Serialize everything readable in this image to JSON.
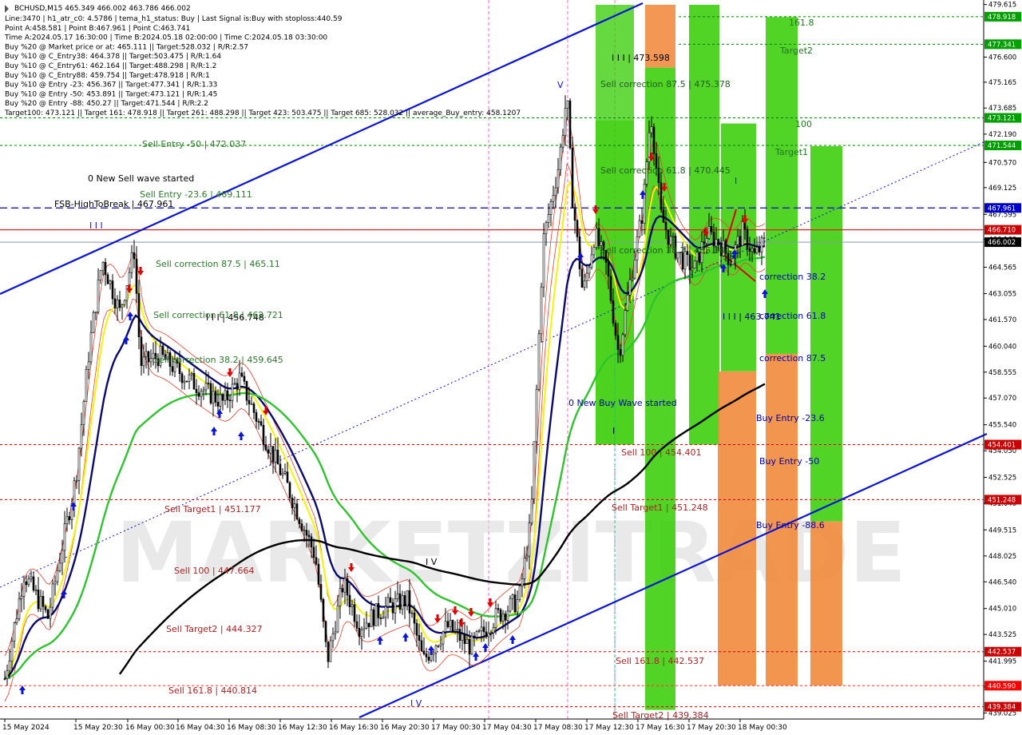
{
  "window": {
    "symbol_line": "BCHUSD,M15  465.349 466.002 463.786 466.002"
  },
  "info_lines": [
    "Line:3470 | h1_atr_c0: 4.5786 | tema_h1_status: Buy | Last Signal is:Buy with stoploss:440.59",
    "Point A:458.581 | Point B:467.961 | Point C:463.741",
    "Time A:2024.05.17 16:30:00 | Time B:2024.05.18 02:00:00 | Time C:2024.05.18 03:30:00",
    "Buy %20 @ Market price or at: 465.111 || Target:528.032 | R/R:2.57",
    "Buy %10 @ C_Entry38: 464.378 || Target:503.475 | R/R:1.64",
    "Buy %10 @ C_Entry61: 462.164 || Target:488.298 | R/R:1.2",
    "Buy %10 @ C_Entry88: 459.754 || Target:478.918 | R/R:1",
    "Buy %10 @ Entry -23: 456.367 || Target:477.341 | R/R:1.33",
    "Buy %10 @ Entry -50: 453.891 || Target:473.121 | R/R:1.45",
    "Buy %20 @ Entry -88: 450.27 || Target:471.544 | R/R:2.2",
    "Target100: 473.121 || Target 161: 478.918 || Target 261: 488.298 || Target 423: 503.475 || Target 685: 528.032 || average_Buy_entry: 458.1207"
  ],
  "watermark": "MARKETZITRADE",
  "colors": {
    "background": "#ffffff",
    "candle": "#000000",
    "channel": "#0a14d8",
    "ma_black": "#000000",
    "ma_navy": "#0a0a6e",
    "ma_yellow": "#f5f500",
    "ma_green": "#2ec42e",
    "envelope": "#e8402a",
    "green_zone": "#33cc00",
    "orange_zone": "#f08a3c",
    "red_level": "#c80000",
    "green_level": "#008000",
    "blue_level": "#0000cc",
    "buy_arrow": "#0a14d8",
    "sell_arrow": "#e00000"
  },
  "chart_labels": {
    "roman_III": "I I I",
    "roman_IV_a": "I V",
    "roman_IV_b": "I V",
    "roman_V": "V",
    "roman_I": "I",
    "roman_I_green": "I",
    "III_473598": "I I I | 473.598",
    "III_456748": "I I I | 456.748",
    "III_463741": "I I I | 463.741",
    "new_sell_wave": "0 New Sell wave started",
    "new_buy_wave": "0 New Buy Wave started",
    "fsb": "FSB-HighToBreak | 467.961",
    "sell_entry_50": "Sell Entry -50 | 472.037",
    "sell_entry_236": "Sell Entry -23.6 | 469.111",
    "sell_corr_875_a": "Sell correction 87.5 | 465.11",
    "sell_corr_618_a": "Sell correction 61.8 | 462.721",
    "sell_corr_382_a": "Sell correction 38.2 | 459.645",
    "sell_target1_a": "Sell Target1 | 451.177",
    "sell_100_a": "Sell 100 | 447.664",
    "sell_target2_a": "Sell Target2 | 444.327",
    "sell_1618_a": "Sell 161.8 | 440.814",
    "sell_corr_875_b": "Sell correction 87.5 | 475.378",
    "sell_corr_618_b": "Sell correction 61.8 | 470.445",
    "sell_corr_382_b": "Sell correction 38.2 | 465.344",
    "sell_100_b": "Sell 100 | 454.401",
    "sell_target1_b": "Sell Target1 | 451.248",
    "sell_1618_b": "Sell 161.8 | 442.537",
    "sell_target2_b": "Sell Target2 | 439.384",
    "t1618": "161.8",
    "target2": "Target2",
    "t100": "100",
    "target1": "Target1",
    "corr_382": "correction 38.2",
    "corr_618": "correction 61.8",
    "corr_875": "correction 87.5",
    "buy_entry_236": "Buy Entry -23.6",
    "buy_entry_50": "Buy Entry -50",
    "buy_entry_886": "Buy Entry -88.6"
  },
  "price_ticks": [
    "479.615",
    "476.600",
    "475.165",
    "473.685",
    "472.190",
    "470.570",
    "469.125",
    "467.595",
    "466.160",
    "464.565",
    "463.055",
    "461.570",
    "460.040",
    "458.555",
    "457.070",
    "455.540",
    "454.050",
    "452.525",
    "451.040",
    "449.515",
    "448.025",
    "446.540",
    "445.010",
    "443.525",
    "441.995",
    "440.510",
    "439.025"
  ],
  "price_badges": [
    {
      "text": "478.918",
      "color": "#00a000"
    },
    {
      "text": "477.341",
      "color": "#00a000"
    },
    {
      "text": "473.121",
      "color": "#00a000"
    },
    {
      "text": "471.544",
      "color": "#00a000"
    },
    {
      "text": "467.961",
      "color": "#0000cc"
    },
    {
      "text": "466.710",
      "color": "#cc0000"
    },
    {
      "text": "466.002",
      "color": "#000000"
    },
    {
      "text": "454.401",
      "color": "#cc0000"
    },
    {
      "text": "451.248",
      "color": "#cc0000"
    },
    {
      "text": "442.537",
      "color": "#cc0000"
    },
    {
      "text": "440.590",
      "color": "#ff0000"
    },
    {
      "text": "439.384",
      "color": "#cc0000"
    }
  ],
  "time_ticks": [
    "15 May 2024",
    "15 May 20:30",
    "16 May 00:30",
    "16 May 04:30",
    "16 May 08:30",
    "16 May 12:30",
    "16 May 16:30",
    "16 May 20:30",
    "17 May 00:30",
    "17 May 04:30",
    "17 May 08:30",
    "17 May 12:30",
    "17 May 16:30",
    "17 May 20:30",
    "18 May 00:30"
  ],
  "chart_data": {
    "type": "candlestick",
    "symbol": "BCHUSD",
    "timeframe": "M15",
    "ylim": [
      439.0,
      479.6
    ],
    "last_price": 466.002,
    "ohlc_last": {
      "open": 465.349,
      "high": 466.002,
      "low": 463.786,
      "close": 466.002
    },
    "close_path": [
      {
        "t": "15 May 2024",
        "price": 441.0
      },
      {
        "t": "15 May 20:30",
        "price": 449.5
      },
      {
        "t": "16 May 00:30",
        "price": 465.5
      },
      {
        "t": "16 May 00:30",
        "price": 461.5
      },
      {
        "t": "16 May 04:30",
        "price": 459.0
      },
      {
        "t": "16 May 08:30",
        "price": 458.0
      },
      {
        "t": "16 May 12:30",
        "price": 453.0
      },
      {
        "t": "16 May 16:30",
        "price": 446.0
      },
      {
        "t": "16 May 20:30",
        "price": 444.5
      },
      {
        "t": "17 May 00:30",
        "price": 444.0
      },
      {
        "t": "17 May 04:30",
        "price": 444.5
      },
      {
        "t": "17 May 08:30",
        "price": 472.0
      },
      {
        "t": "17 May 12:30",
        "price": 466.0
      },
      {
        "t": "17 May 16:30",
        "price": 472.0
      },
      {
        "t": "17 May 20:30",
        "price": 465.0
      },
      {
        "t": "18 May 00:30",
        "price": 466.0
      }
    ],
    "points": {
      "A": 458.581,
      "B": 467.961,
      "C": 463.741
    },
    "levels": {
      "fsb_high_to_break": 467.961,
      "sell_entry_m50": 472.037,
      "sell_entry_m23_6": 469.111,
      "target100": 473.121,
      "target161": 478.918,
      "target2_line": 477.341,
      "target1_line": 471.544,
      "sell_100": 454.401,
      "sell_target1": 451.248,
      "sell_161_8": 442.537,
      "sell_target2": 439.384,
      "stoploss": 440.59,
      "red_line": 466.71
    }
  }
}
